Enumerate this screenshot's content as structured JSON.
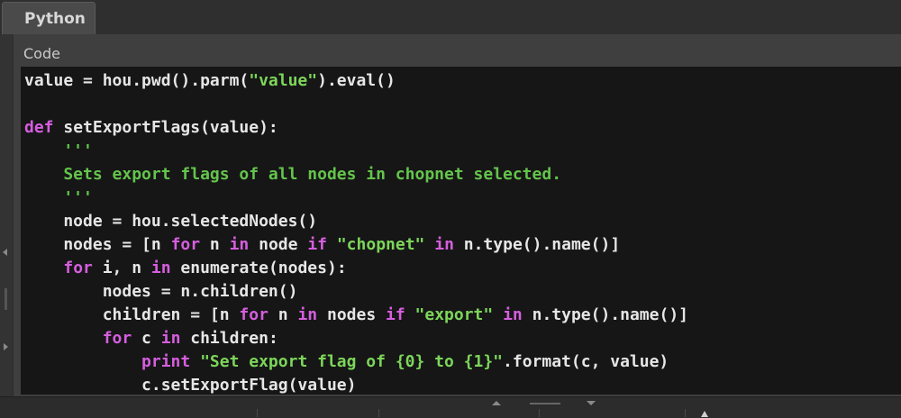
{
  "tab": {
    "label": "Python"
  },
  "section": {
    "label": "Code"
  },
  "code": {
    "lines": [
      [
        {
          "t": "value = hou.pwd().parm(",
          "c": ""
        },
        {
          "t": "\"value\"",
          "c": "str"
        },
        {
          "t": ").eval()",
          "c": ""
        }
      ],
      [],
      [
        {
          "t": "def",
          "c": "kw"
        },
        {
          "t": " setExportFlags(value):",
          "c": ""
        }
      ],
      [
        {
          "t": "    '''",
          "c": "doc"
        }
      ],
      [
        {
          "t": "    Sets export flags of all nodes in chopnet selected.",
          "c": "doc"
        }
      ],
      [
        {
          "t": "    '''",
          "c": "doc"
        }
      ],
      [
        {
          "t": "    node = hou.selectedNodes()",
          "c": ""
        }
      ],
      [
        {
          "t": "    nodes = [n ",
          "c": ""
        },
        {
          "t": "for",
          "c": "kw"
        },
        {
          "t": " n ",
          "c": ""
        },
        {
          "t": "in",
          "c": "kw"
        },
        {
          "t": " node ",
          "c": ""
        },
        {
          "t": "if",
          "c": "kw"
        },
        {
          "t": " ",
          "c": ""
        },
        {
          "t": "\"chopnet\"",
          "c": "str"
        },
        {
          "t": " ",
          "c": ""
        },
        {
          "t": "in",
          "c": "kw"
        },
        {
          "t": " n.type().name()]",
          "c": ""
        }
      ],
      [
        {
          "t": "    ",
          "c": ""
        },
        {
          "t": "for",
          "c": "kw"
        },
        {
          "t": " i, n ",
          "c": ""
        },
        {
          "t": "in",
          "c": "kw"
        },
        {
          "t": " enumerate(nodes):",
          "c": ""
        }
      ],
      [
        {
          "t": "        nodes = n.children()",
          "c": ""
        }
      ],
      [
        {
          "t": "        children = [n ",
          "c": ""
        },
        {
          "t": "for",
          "c": "kw"
        },
        {
          "t": " n ",
          "c": ""
        },
        {
          "t": "in",
          "c": "kw"
        },
        {
          "t": " nodes ",
          "c": ""
        },
        {
          "t": "if",
          "c": "kw"
        },
        {
          "t": " ",
          "c": ""
        },
        {
          "t": "\"export\"",
          "c": "str"
        },
        {
          "t": " ",
          "c": ""
        },
        {
          "t": "in",
          "c": "kw"
        },
        {
          "t": " n.type().name()]",
          "c": ""
        }
      ],
      [
        {
          "t": "        ",
          "c": ""
        },
        {
          "t": "for",
          "c": "kw"
        },
        {
          "t": " c ",
          "c": ""
        },
        {
          "t": "in",
          "c": "kw"
        },
        {
          "t": " children:",
          "c": ""
        }
      ],
      [
        {
          "t": "            ",
          "c": ""
        },
        {
          "t": "print",
          "c": "kw"
        },
        {
          "t": " ",
          "c": ""
        },
        {
          "t": "\"Set export flag of {0} to {1}\"",
          "c": "str"
        },
        {
          "t": ".format(c, value)",
          "c": ""
        }
      ],
      [
        {
          "t": "            c.setExportFlag(value)",
          "c": ""
        }
      ]
    ]
  },
  "colors": {
    "editor_bg": "#161616",
    "keyword": "#d65ee0",
    "string": "#7cd65a",
    "docstring": "#64c44c",
    "text": "#e6e6e6"
  },
  "icons": [
    "collapse-left-icon",
    "expand-right-icon",
    "splitter-up-icon",
    "splitter-down-icon",
    "pointer-cursor-icon"
  ]
}
